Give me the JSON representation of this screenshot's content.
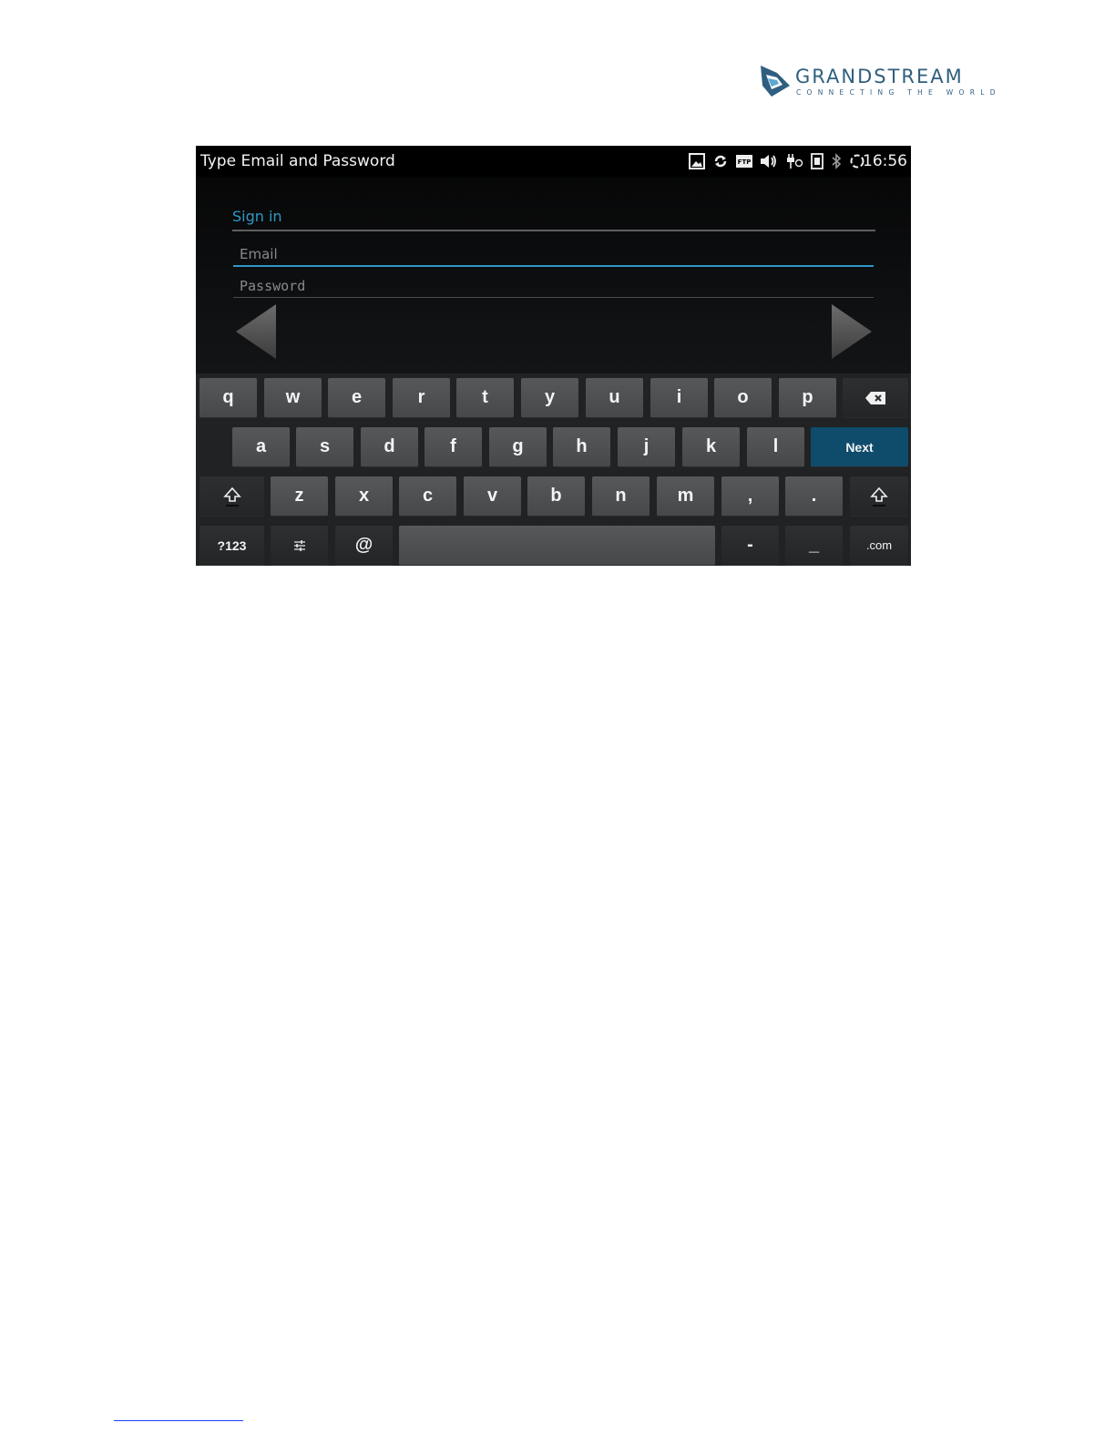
{
  "logo": {
    "name": "GRANDSTREAM",
    "tagline": "CONNECTING THE WORLD"
  },
  "statusbar": {
    "title": "Type Email and Password",
    "time": "16:56",
    "icons": [
      "image-icon",
      "sync-icon",
      "ftp-icon",
      "volume-icon",
      "usb-icon",
      "sim-icon",
      "bluetooth-icon",
      "loading-icon"
    ]
  },
  "form": {
    "header": "Sign in",
    "email_placeholder": "Email",
    "password_placeholder": "Password"
  },
  "keyboard": {
    "row1": [
      "q",
      "w",
      "e",
      "r",
      "t",
      "y",
      "u",
      "i",
      "o",
      "p"
    ],
    "row2": [
      "a",
      "s",
      "d",
      "f",
      "g",
      "h",
      "j",
      "k",
      "l"
    ],
    "row3": [
      "z",
      "x",
      "c",
      "v",
      "b",
      "n",
      "m",
      ",",
      "."
    ],
    "next_label": "Next",
    "numbers_label": "?123",
    "at_label": "@",
    "dash_label": "-",
    "underscore_label": "_",
    "dotcom_label": ".com",
    "backspace_icon": "backspace-icon",
    "shift_icon": "shift-icon",
    "settings_icon": "sliders-icon"
  },
  "colors": {
    "accent": "#2f97c6",
    "next_key": "#0f4c6c",
    "logo": "#2f5f7f"
  }
}
